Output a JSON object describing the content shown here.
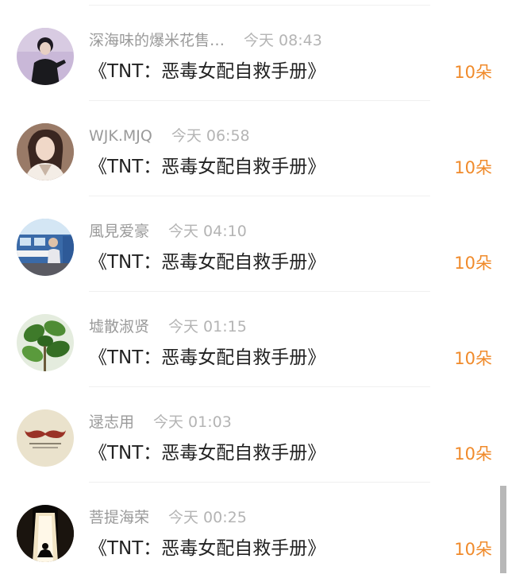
{
  "entries": [
    {
      "username": "深海味的爆米花售…",
      "time": "今天 08:43",
      "title": "《TNT：恶毒女配自救手册》",
      "amount": "10朵",
      "avatar": "person-dark-portrait"
    },
    {
      "username": "WJK.MJQ",
      "time": "今天 06:58",
      "title": "《TNT：恶毒女配自救手册》",
      "amount": "10朵",
      "avatar": "woman-portrait"
    },
    {
      "username": "風見爱豪",
      "time": "今天 04:10",
      "title": "《TNT：恶毒女配自救手册》",
      "amount": "10朵",
      "avatar": "street-bus-photo"
    },
    {
      "username": "墟散淑贤",
      "time": "今天 01:15",
      "title": "《TNT：恶毒女配自救手册》",
      "amount": "10朵",
      "avatar": "green-plant-photo"
    },
    {
      "username": "逯志用",
      "time": "今天 01:03",
      "title": "《TNT：恶毒女配自救手册》",
      "amount": "10朵",
      "avatar": "mustache-logo"
    },
    {
      "username": "菩提海荣",
      "time": "今天 00:25",
      "title": "《TNT：恶毒女配自救手册》",
      "amount": "10朵",
      "avatar": "meditation-silhouette"
    }
  ],
  "colors": {
    "username": "#9a9a9a",
    "time": "#b4b4b4",
    "title": "#222222",
    "amount": "#f08a2a",
    "divider": "#f0f0f0"
  }
}
